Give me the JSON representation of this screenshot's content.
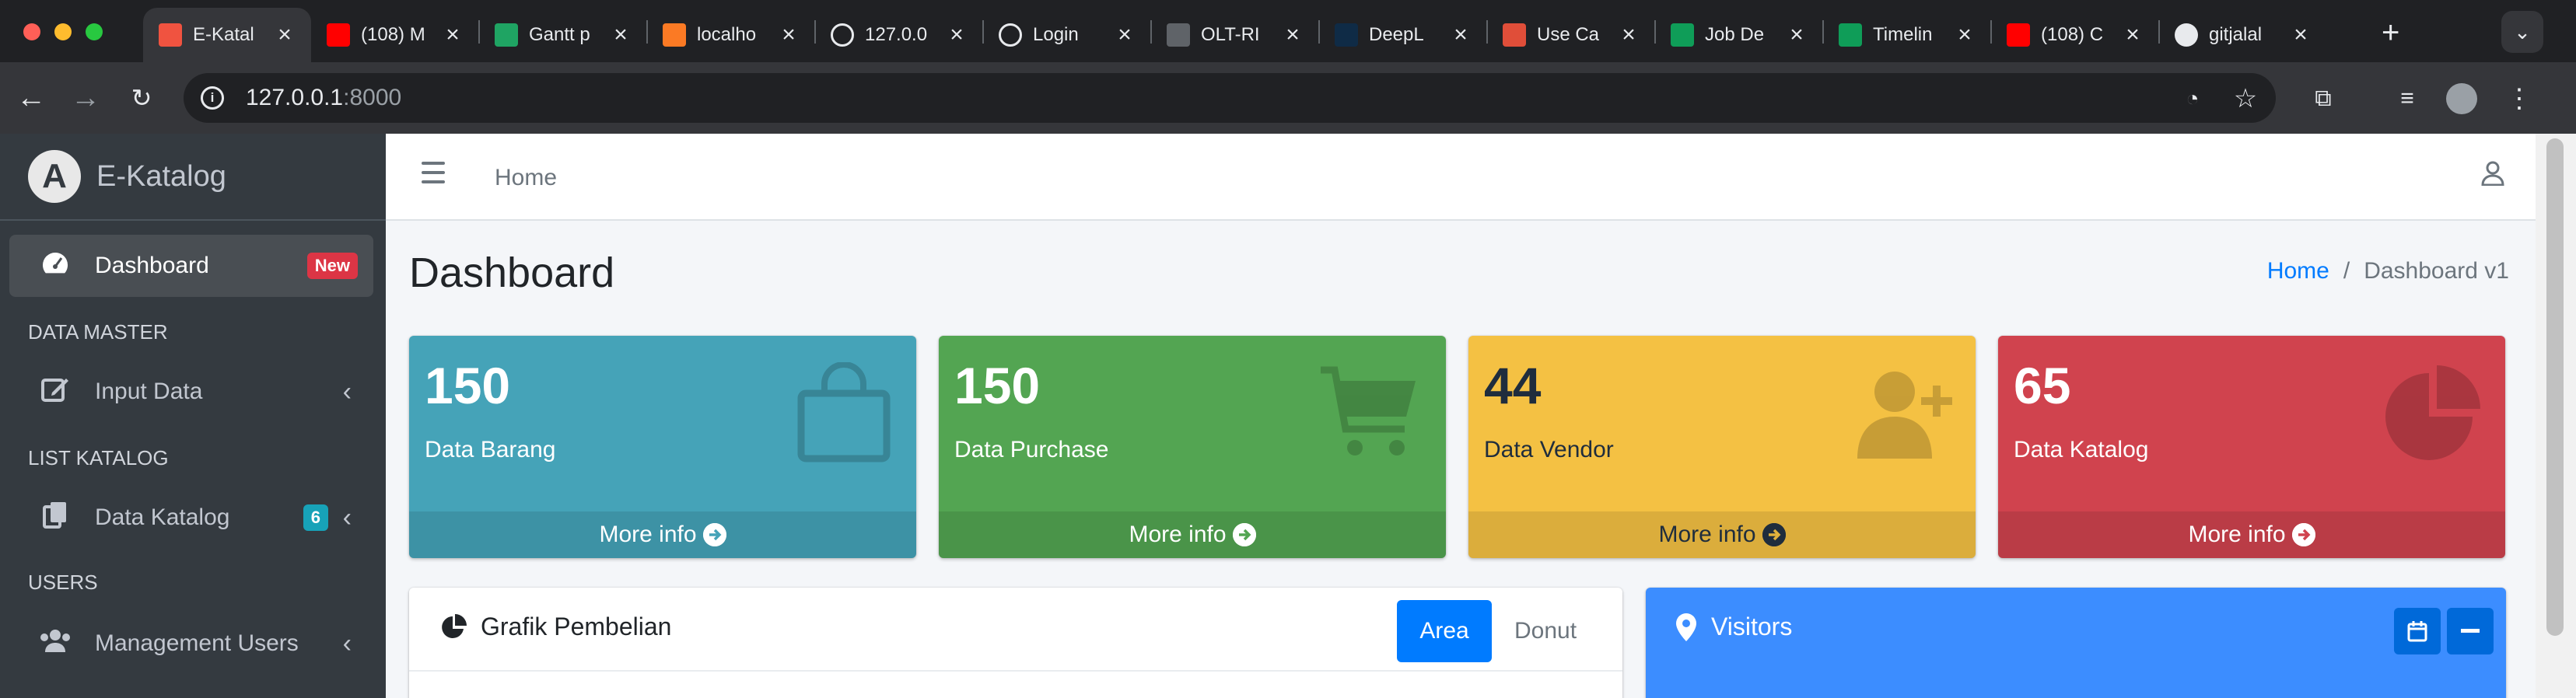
{
  "browser": {
    "tabs": [
      {
        "title": "E-Katal",
        "favicon": "laravel-icon",
        "color": "#f05340",
        "active": true
      },
      {
        "title": "(108) M",
        "favicon": "youtube-icon",
        "color": "#ff0000",
        "active": false
      },
      {
        "title": "Gantt p",
        "favicon": "google-drive-icon",
        "color": "#1fa463",
        "active": false
      },
      {
        "title": "localho",
        "favicon": "xampp-icon",
        "color": "#fb7a24",
        "active": false
      },
      {
        "title": "127.0.0",
        "favicon": "globe-icon",
        "color": "#9aa0a6",
        "active": false
      },
      {
        "title": "Login",
        "favicon": "globe-icon",
        "color": "#9aa0a6",
        "active": false
      },
      {
        "title": "OLT-RI",
        "favicon": "router-icon",
        "color": "#5f6368",
        "active": false
      },
      {
        "title": "DeepL",
        "favicon": "deepl-icon",
        "color": "#0f2b46",
        "active": false
      },
      {
        "title": "Use Ca",
        "favicon": "diagram-icon",
        "color": "#e04e39",
        "active": false
      },
      {
        "title": "Job De",
        "favicon": "google-sheets-icon",
        "color": "#0f9d58",
        "active": false
      },
      {
        "title": "Timelin",
        "favicon": "google-sheets-icon",
        "color": "#0f9d58",
        "active": false
      },
      {
        "title": "(108) C",
        "favicon": "youtube-icon",
        "color": "#ff0000",
        "active": false
      },
      {
        "title": "gitjalal",
        "favicon": "github-icon",
        "color": "#ffffff",
        "active": false
      }
    ],
    "new_tab": "+",
    "url_host": "127.0.0.1",
    "url_port": ":8000"
  },
  "sidebar": {
    "brand": "E-Katalog",
    "brand_logo": "A",
    "items": [
      {
        "label": "Dashboard",
        "icon": "tachometer-icon",
        "badge": "New",
        "badge_color": "#dc3545"
      },
      {
        "header": "DATA MASTER"
      },
      {
        "label": "Input Data",
        "icon": "edit-icon"
      },
      {
        "header": "LIST KATALOG"
      },
      {
        "label": "Data Katalog",
        "icon": "copy-icon",
        "badge": "6",
        "badge_color": "#17a2b8"
      },
      {
        "header": "USERS"
      },
      {
        "label": "Management Users",
        "icon": "users-icon"
      }
    ]
  },
  "topnav": {
    "home": "Home"
  },
  "page": {
    "title": "Dashboard",
    "breadcrumb": {
      "home": "Home",
      "sep": "/",
      "current": "Dashboard v1"
    }
  },
  "info_boxes": [
    {
      "value": "150",
      "label": "Data Barang",
      "footer": "More info",
      "color": "#45a3b8",
      "icon": "shopping-bag-icon"
    },
    {
      "value": "150",
      "label": "Data Purchase",
      "footer": "More info",
      "color": "#53a552",
      "icon": "shopping-cart-icon"
    },
    {
      "value": "44",
      "label": "Data Vendor",
      "footer": "More info",
      "color": "#f4c143",
      "icon": "user-plus-icon"
    },
    {
      "value": "65",
      "label": "Data Katalog",
      "footer": "More info",
      "color": "#d0434e",
      "icon": "pie-chart-icon"
    }
  ],
  "cards": {
    "left": {
      "title": "Grafik Pembelian",
      "tab_active": "Area",
      "tab_other": "Donut"
    },
    "right": {
      "title": "Visitors",
      "color": "#3c8dff"
    }
  }
}
